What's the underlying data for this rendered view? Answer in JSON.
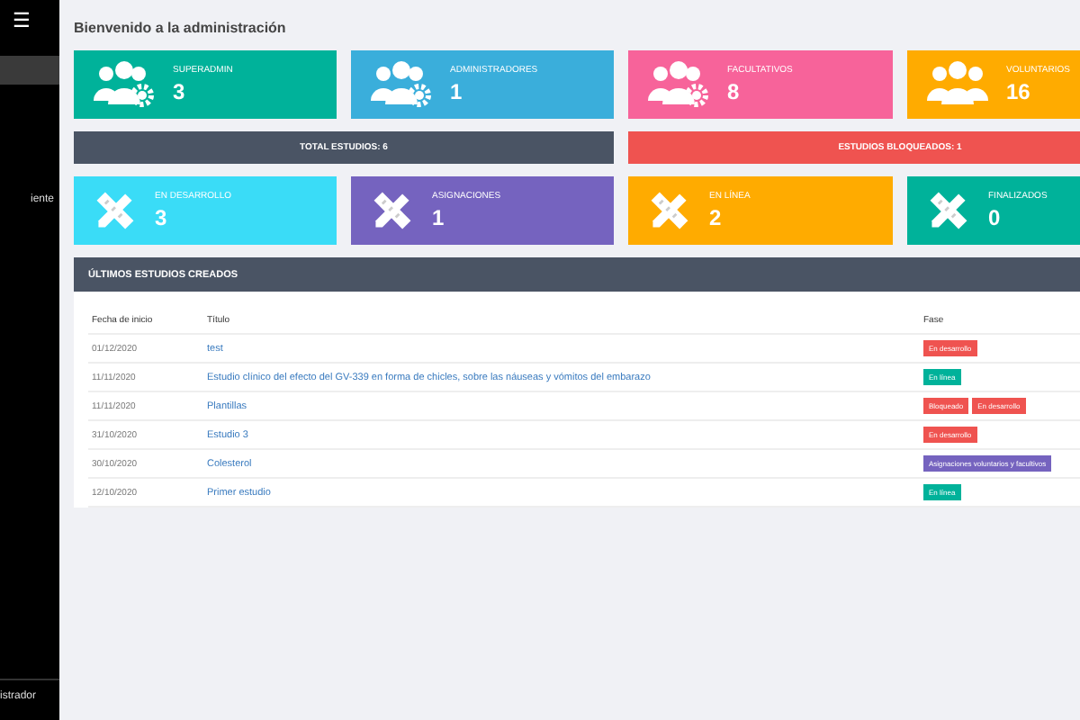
{
  "sidebar": {
    "menu_icon": "☰",
    "items": [
      {
        "selected": true
      },
      {
        "label": "iente",
        "selected": false
      }
    ],
    "footer": "istrador"
  },
  "page_title": "Bienvenido a la administración",
  "user_cards": [
    {
      "label": "SUPERADMIN",
      "value": "3",
      "color": "#00b29a",
      "kind": "users-gear"
    },
    {
      "label": "ADMINISTRADORES",
      "value": "1",
      "color": "#3aaedb",
      "kind": "users-gear"
    },
    {
      "label": "FACULTATIVOS",
      "value": "8",
      "color": "#f7639a",
      "kind": "users-gear"
    },
    {
      "label": "VOLUNTARIOS",
      "value": "16",
      "color": "#ffab00",
      "kind": "users"
    }
  ],
  "banners": [
    {
      "text": "TOTAL ESTUDIOS: 6",
      "color": "#4a5464"
    },
    {
      "text": "ESTUDIOS BLOQUEADOS: 1",
      "color": "#ef5350"
    }
  ],
  "study_cards": [
    {
      "label": "EN DESARROLLO",
      "value": "3",
      "color": "#3adcf7"
    },
    {
      "label": "ASIGNACIONES",
      "value": "1",
      "color": "#7563bf"
    },
    {
      "label": "EN LÍNEA",
      "value": "2",
      "color": "#ffab00"
    },
    {
      "label": "FINALIZADOS",
      "value": "0",
      "color": "#00b29a"
    }
  ],
  "table": {
    "title": "ÚLTIMOS ESTUDIOS CREADOS",
    "columns": [
      "Fecha de inicio",
      "Título",
      "Fase"
    ],
    "rows": [
      {
        "date": "01/12/2020",
        "title": "test",
        "phases": [
          {
            "text": "En desarrollo",
            "color": "#ef5350"
          }
        ]
      },
      {
        "date": "11/11/2020",
        "title": "Estudio clínico del efecto del GV-339 en forma de chicles, sobre las náuseas y vómitos del embarazo",
        "phases": [
          {
            "text": "En línea",
            "color": "#00b29a"
          }
        ]
      },
      {
        "date": "11/11/2020",
        "title": "Plantillas",
        "phases": [
          {
            "text": "Bloqueado",
            "color": "#ef5350"
          },
          {
            "text": "En desarrollo",
            "color": "#ef5350"
          }
        ]
      },
      {
        "date": "31/10/2020",
        "title": "Estudio 3",
        "phases": [
          {
            "text": "En desarrollo",
            "color": "#ef5350"
          }
        ]
      },
      {
        "date": "30/10/2020",
        "title": "Colesterol",
        "phases": [
          {
            "text": "Asignaciones voluntarios y facultivos",
            "color": "#7563bf"
          }
        ]
      },
      {
        "date": "12/10/2020",
        "title": "Primer estudio",
        "phases": [
          {
            "text": "En línea",
            "color": "#00b29a"
          }
        ]
      }
    ]
  }
}
